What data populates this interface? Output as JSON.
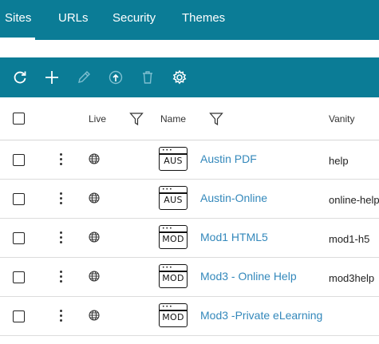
{
  "tabs": [
    {
      "label": "Sites",
      "active": true
    },
    {
      "label": "URLs",
      "active": false
    },
    {
      "label": "Security",
      "active": false
    },
    {
      "label": "Themes",
      "active": false
    }
  ],
  "toolbar": {
    "buttons": [
      "refresh-icon",
      "add-icon",
      "edit-icon",
      "publish-icon",
      "delete-icon",
      "settings-icon"
    ]
  },
  "table": {
    "headers": {
      "live": "Live",
      "name": "Name",
      "vanity": "Vanity"
    },
    "rows": [
      {
        "code": "AUS",
        "name": "Austin PDF",
        "vanity": "help"
      },
      {
        "code": "AUS",
        "name": "Austin-Online",
        "vanity": "online-help"
      },
      {
        "code": "MOD",
        "name": "Mod1 HTML5",
        "vanity": "mod1-h5"
      },
      {
        "code": "MOD",
        "name": "Mod3 - Online Help",
        "vanity": "mod3help"
      },
      {
        "code": "MOD",
        "name": "Mod3 -Private eLearning",
        "vanity": ""
      }
    ]
  },
  "colors": {
    "brand": "#0b7c96",
    "link": "#3388bb"
  }
}
